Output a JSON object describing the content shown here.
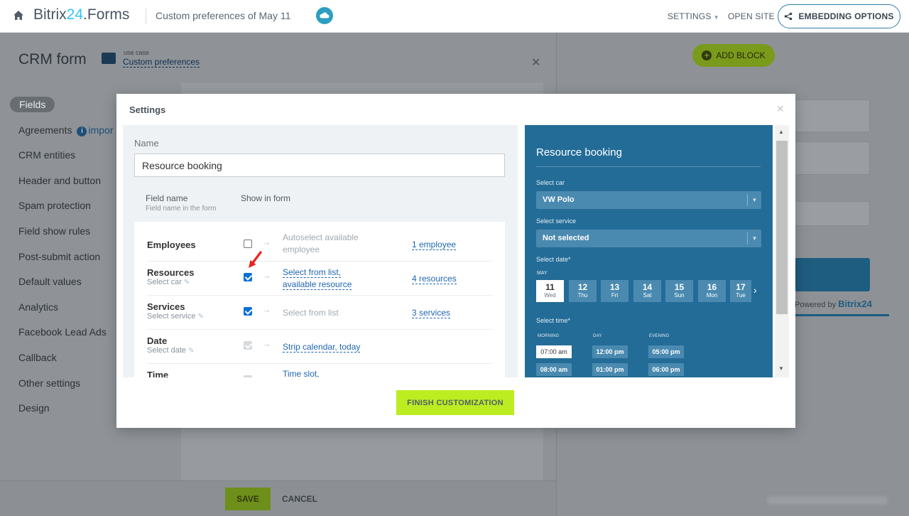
{
  "topbar": {
    "brand_prefix": "Bitrix",
    "brand_num": "24",
    "brand_suffix": ".Forms",
    "subtitle": "Custom preferences of May 11",
    "settings_label": "SETTINGS",
    "open_site_label": "OPEN SITE",
    "embedding_label": "EMBEDDING OPTIONS"
  },
  "editor": {
    "title": "CRM form",
    "use_case_small": "use case",
    "use_case_link": "Custom preferences"
  },
  "sidebar": {
    "items": [
      {
        "label": "Fields"
      },
      {
        "label": "Agreements"
      },
      {
        "label": "CRM entities"
      },
      {
        "label": "Header and button"
      },
      {
        "label": "Spam protection"
      },
      {
        "label": "Field show rules"
      },
      {
        "label": "Post-submit action"
      },
      {
        "label": "Default values"
      },
      {
        "label": "Analytics"
      },
      {
        "label": "Facebook Lead Ads"
      },
      {
        "label": "Callback"
      },
      {
        "label": "Other settings"
      },
      {
        "label": "Design"
      }
    ],
    "agreements_info": "impor"
  },
  "bottom": {
    "save_label": "SAVE",
    "cancel_label": "CANCEL"
  },
  "right": {
    "add_block_label": "ADD BLOCK",
    "powered_prefix": "Powered by",
    "powered_brand": "Bitrix",
    "powered_num": "24"
  },
  "modal": {
    "title": "Settings",
    "name_label": "Name",
    "name_value": "Resource booking",
    "col_field_name": "Field name",
    "col_field_name_sub": "Field name in the form",
    "col_show_in_form": "Show in form",
    "finish_label": "FINISH CUSTOMIZATION",
    "fields": [
      {
        "name": "Employees",
        "sub": "",
        "mode": "Autoselect available employee",
        "count": "1 employee",
        "state": "unchecked"
      },
      {
        "name": "Resources",
        "sub": "Select car",
        "mode": "Select from list, available resource",
        "count": "4 resources",
        "state": "checked"
      },
      {
        "name": "Services",
        "sub": "Select service",
        "mode": "Select from list",
        "count": "3 services",
        "state": "checked"
      },
      {
        "name": "Date",
        "sub": "Select date",
        "mode": "Strip calendar, today",
        "count": "",
        "state": "disabled"
      },
      {
        "name": "Time",
        "sub": "",
        "mode": "Time slot,",
        "count": "",
        "state": "disabled"
      }
    ],
    "mode_lines": {
      "employees_1": "Autoselect available",
      "employees_2": "employee",
      "resources_1": "Select from list,",
      "resources_2": "available resource"
    }
  },
  "preview": {
    "title": "Resource booking",
    "car_label": "Select car",
    "car_value": "VW Polo",
    "service_label": "Select service",
    "service_value": "Not selected",
    "date_label": "Select date*",
    "month": "MAY",
    "days": [
      {
        "num": "11",
        "wd": "Wed"
      },
      {
        "num": "12",
        "wd": "Thu"
      },
      {
        "num": "13",
        "wd": "Fri"
      },
      {
        "num": "14",
        "wd": "Sat"
      },
      {
        "num": "15",
        "wd": "Sun"
      },
      {
        "num": "16",
        "wd": "Mon"
      },
      {
        "num": "17",
        "wd": "Tue"
      }
    ],
    "time_label": "Select time*",
    "periods": [
      "MORNING",
      "DAY",
      "EVENING"
    ],
    "slots": {
      "morning": [
        "07:00 am",
        "08:00 am"
      ],
      "day": [
        "12:00 pm",
        "01:00 pm"
      ],
      "evening": [
        "05:00 pm",
        "06:00 pm"
      ]
    }
  },
  "colors": {
    "accent_green": "#bbed21",
    "preview_blue": "#236c97",
    "link_blue": "#2067b0",
    "checkbox_blue": "#0b6fd6",
    "annotation_red": "#e8231e"
  }
}
